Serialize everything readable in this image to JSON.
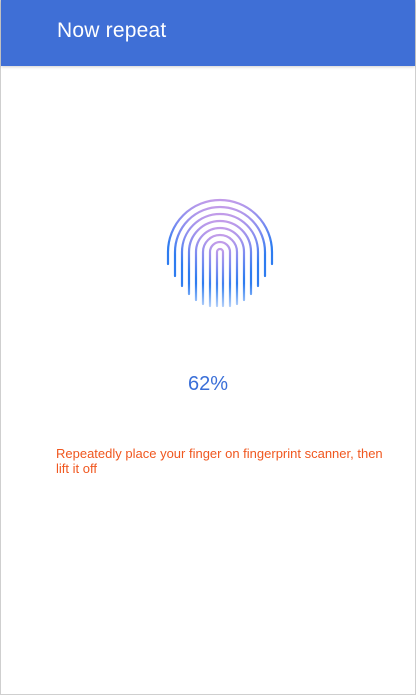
{
  "app_bar": {
    "title": "Now repeat"
  },
  "enrollment": {
    "progress_percent": 62,
    "progress_label": "62%",
    "hint": "Repeatedly place your finger on fingerprint scanner, then lift it off"
  },
  "colors": {
    "app_bar": "#3f6fd6",
    "progress_text": "#3a6fd8",
    "hint_text": "#f0571f",
    "fingerprint_top": "#b08ae8",
    "fingerprint_bottom": "#2e7cf0"
  },
  "icons": {
    "fingerprint": "fingerprint-icon"
  }
}
